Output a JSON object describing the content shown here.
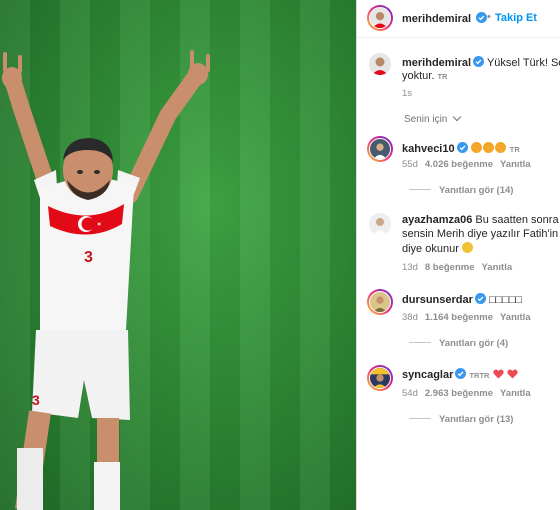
{
  "post": {
    "author": "merihdemiral",
    "follow_label": "Takip Et",
    "caption": "Yüksel Türk! Senin",
    "caption_cont": "yoktur.",
    "caption_lang": "TR",
    "caption_age": "1s",
    "for_you_label": "Senin için"
  },
  "comments": [
    {
      "user": "kahveci10",
      "verified": true,
      "emojis": [
        "#f4a62a",
        "#f4a62a",
        "#f4a62a"
      ],
      "lang": "TR",
      "age": "55d",
      "likes": "4.026 beğenme",
      "reply_label": "Yanıtla",
      "view_replies": "Yanıtları gör (14)"
    },
    {
      "user": "ayazhamza06",
      "verified": false,
      "text_line1": "Bu saatten sonra n",
      "text_line2": "sensin Merih diye yazılır Fatih'in A",
      "text_line3": "diye okunur",
      "age": "13d",
      "likes": "8 beğenme",
      "reply_label": "Yanıtla"
    },
    {
      "user": "dursunserdar",
      "verified": true,
      "text": "□□□□□",
      "age": "38d",
      "likes": "1.164 beğenme",
      "reply_label": "Yanıtla",
      "view_replies": "Yanıtları gör (4)"
    },
    {
      "user": "syncaglar",
      "verified": true,
      "lang_a": "TR",
      "lang_b": "TR",
      "age": "54d",
      "likes": "2.963 beğenme",
      "reply_label": "Yanıtla",
      "view_replies": "Yanıtları gör (13)"
    }
  ],
  "photo": {
    "jersey_number": "3"
  },
  "colors": {
    "link_blue": "#0095f6",
    "verified_blue": "#3897f0",
    "meta_gray": "#8e8e8e",
    "heart_red": "#ed4956",
    "jersey_red": "#e30a17",
    "pitch_green": "#2f8b35"
  }
}
